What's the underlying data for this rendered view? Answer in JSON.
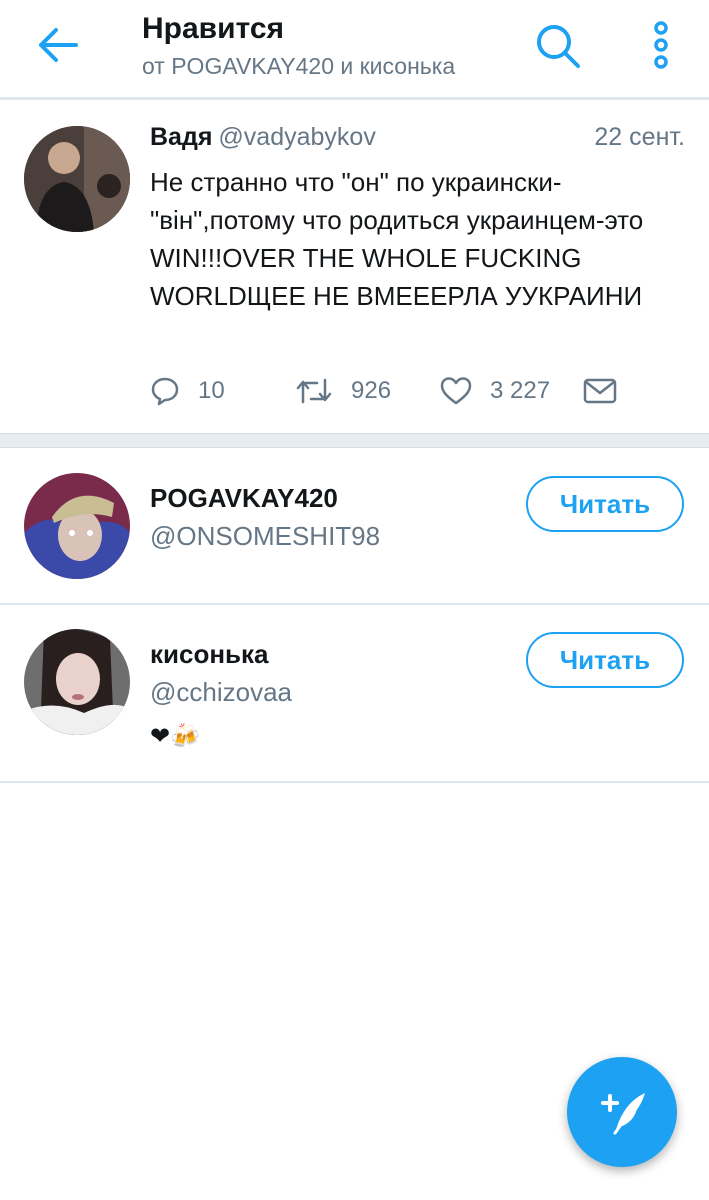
{
  "header": {
    "title": "Нравится",
    "subtitle": "от POGAVKAY420 и кисонька"
  },
  "tweet": {
    "name": "Вадя",
    "handle": "@vadyabykov",
    "date": "22 сент.",
    "text": "Не странно что \"он\" по украински-\"вiн\",потому что родиться украинцем-это WIN!!!OVER THE WHOLE FUCKING WORLDЩЕЕ НЕ ВМЕЕЕРЛА УУКРАИНИ",
    "replies": "10",
    "retweets": "926",
    "likes": "3 227"
  },
  "users": [
    {
      "name": "POGAVKAY420",
      "handle": "@ONSOMESHIT98",
      "bio": "",
      "follow_label": "Читать"
    },
    {
      "name": "кисонька",
      "handle": "@cchizovaa",
      "bio": "❤🍻",
      "follow_label": "Читать"
    }
  ],
  "colors": {
    "accent": "#1da1f2",
    "text_primary": "#14171a",
    "text_secondary": "#657786",
    "divider": "#e1e8ed"
  },
  "icons": {
    "back": "arrow-left-icon",
    "search": "search-icon",
    "more": "more-vertical-icon",
    "reply": "reply-icon",
    "retweet": "retweet-icon",
    "like": "heart-icon",
    "dm": "envelope-icon",
    "compose": "compose-quill-icon"
  }
}
